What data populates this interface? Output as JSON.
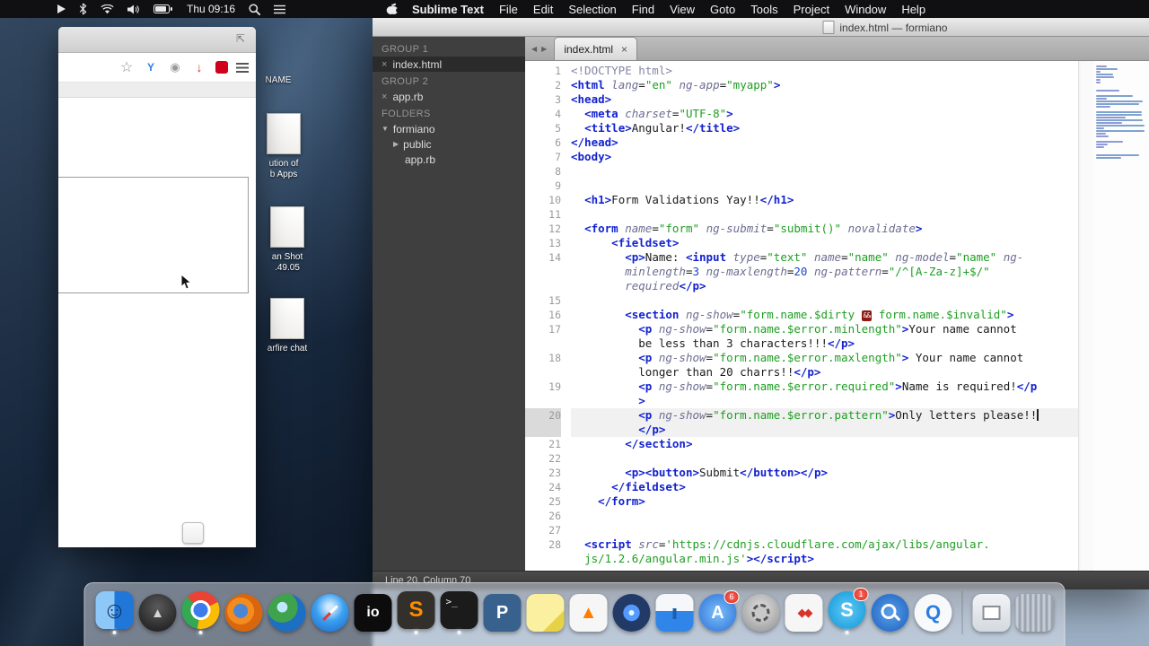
{
  "menubar": {
    "status_icons_pre": [
      "play",
      "bluetooth",
      "wifi",
      "volume",
      "battery"
    ],
    "status_icons_post": [
      "spotlight",
      "list"
    ],
    "clock": "Thu 09:16",
    "app_name": "Sublime Text",
    "menus": [
      "File",
      "Edit",
      "Selection",
      "Find",
      "View",
      "Goto",
      "Tools",
      "Project",
      "Window",
      "Help"
    ]
  },
  "browser": {
    "toolbar_icons": [
      "star",
      "share",
      "shield",
      "download",
      "adblock",
      "menu"
    ]
  },
  "desktop": {
    "icons": [
      {
        "label_lines": [
          "NAME"
        ],
        "thumb": false
      },
      {
        "label_lines": [
          "ution of",
          "b Apps"
        ],
        "thumb": true
      },
      {
        "label_lines": [
          "an Shot",
          ".49.05"
        ],
        "thumb": true
      },
      {
        "label_lines": [
          "arfire chat"
        ],
        "thumb": true
      }
    ]
  },
  "sublime": {
    "title": "index.html — formiano",
    "tab": {
      "label": "index.html"
    },
    "status": "Line 20, Column 70",
    "sidebar": {
      "sections": [
        {
          "header": "GROUP 1",
          "rows": [
            {
              "t": "file",
              "label": "index.html",
              "close": true,
              "selected": true,
              "indent": 0
            }
          ]
        },
        {
          "header": "GROUP 2",
          "rows": [
            {
              "t": "file",
              "label": "app.rb",
              "close": true,
              "indent": 0
            }
          ]
        },
        {
          "header": "FOLDERS",
          "rows": [
            {
              "t": "folder-open",
              "label": "formiano",
              "indent": 0
            },
            {
              "t": "folder",
              "label": "public",
              "indent": 1
            },
            {
              "t": "plain",
              "label": "app.rb",
              "indent": 2
            }
          ]
        }
      ]
    },
    "editor": {
      "rows": [
        {
          "n": "1",
          "seg": [
            [
              "doc",
              "<!DOCTYPE html>"
            ]
          ]
        },
        {
          "n": "2",
          "seg": [
            [
              "tag",
              "<html"
            ],
            [
              "pln",
              " "
            ],
            [
              "att",
              "lang"
            ],
            [
              "pun",
              "="
            ],
            [
              "str",
              "\"en\""
            ],
            [
              "pln",
              " "
            ],
            [
              "att",
              "ng-app"
            ],
            [
              "pun",
              "="
            ],
            [
              "str",
              "\"myapp\""
            ],
            [
              "tag",
              ">"
            ]
          ]
        },
        {
          "n": "3",
          "seg": [
            [
              "tag",
              "<head>"
            ]
          ]
        },
        {
          "n": "4",
          "seg": [
            [
              "pln",
              "  "
            ],
            [
              "tag",
              "<meta"
            ],
            [
              "pln",
              " "
            ],
            [
              "att",
              "charset"
            ],
            [
              "pun",
              "="
            ],
            [
              "str",
              "\"UTF-8\""
            ],
            [
              "tag",
              ">"
            ]
          ]
        },
        {
          "n": "5",
          "seg": [
            [
              "pln",
              "  "
            ],
            [
              "tag",
              "<title>"
            ],
            [
              "pln",
              "Angular!"
            ],
            [
              "tag",
              "</title>"
            ]
          ]
        },
        {
          "n": "6",
          "seg": [
            [
              "tag",
              "</head>"
            ]
          ]
        },
        {
          "n": "7",
          "seg": [
            [
              "tag",
              "<body>"
            ]
          ]
        },
        {
          "n": "8",
          "seg": []
        },
        {
          "n": "9",
          "seg": []
        },
        {
          "n": "10",
          "seg": [
            [
              "pln",
              "  "
            ],
            [
              "tag",
              "<h1>"
            ],
            [
              "pln",
              "Form Validations Yay!!"
            ],
            [
              "tag",
              "</h1>"
            ]
          ]
        },
        {
          "n": "11",
          "seg": []
        },
        {
          "n": "12",
          "seg": [
            [
              "pln",
              "  "
            ],
            [
              "tag",
              "<form"
            ],
            [
              "pln",
              " "
            ],
            [
              "att",
              "name"
            ],
            [
              "pun",
              "="
            ],
            [
              "str",
              "\"form\""
            ],
            [
              "pln",
              " "
            ],
            [
              "att",
              "ng-submit"
            ],
            [
              "pun",
              "="
            ],
            [
              "str",
              "\"submit()\""
            ],
            [
              "pln",
              " "
            ],
            [
              "att",
              "novalidate"
            ],
            [
              "tag",
              ">"
            ]
          ]
        },
        {
          "n": "13",
          "seg": [
            [
              "pln",
              "      "
            ],
            [
              "tag",
              "<fieldset>"
            ]
          ]
        },
        {
          "n": "14",
          "seg": [
            [
              "pln",
              "        "
            ],
            [
              "tag",
              "<p>"
            ],
            [
              "pln",
              "Name: "
            ],
            [
              "tag",
              "<input"
            ],
            [
              "pln",
              " "
            ],
            [
              "att",
              "type"
            ],
            [
              "pun",
              "="
            ],
            [
              "str",
              "\"text\""
            ],
            [
              "pln",
              " "
            ],
            [
              "att",
              "name"
            ],
            [
              "pun",
              "="
            ],
            [
              "str",
              "\"name\""
            ],
            [
              "pln",
              " "
            ],
            [
              "att",
              "ng-model"
            ],
            [
              "pun",
              "="
            ],
            [
              "str",
              "\"name\""
            ],
            [
              "pln",
              " "
            ],
            [
              "att",
              "ng-"
            ]
          ]
        },
        {
          "seg": [
            [
              "pln",
              "        "
            ],
            [
              "att",
              "minlength"
            ],
            [
              "pun",
              "="
            ],
            [
              "num",
              "3"
            ],
            [
              "pln",
              " "
            ],
            [
              "att",
              "ng-maxlength"
            ],
            [
              "pun",
              "="
            ],
            [
              "num",
              "20"
            ],
            [
              "pln",
              " "
            ],
            [
              "att",
              "ng-pattern"
            ],
            [
              "pun",
              "="
            ],
            [
              "str",
              "\"/^[A-Za-z]+$/\""
            ]
          ]
        },
        {
          "seg": [
            [
              "pln",
              "        "
            ],
            [
              "att",
              "required"
            ],
            [
              "tag",
              "</p>"
            ]
          ]
        },
        {
          "n": "15",
          "seg": []
        },
        {
          "n": "16",
          "seg": [
            [
              "pln",
              "        "
            ],
            [
              "tag",
              "<section"
            ],
            [
              "pln",
              " "
            ],
            [
              "att",
              "ng-show"
            ],
            [
              "pun",
              "="
            ],
            [
              "str",
              "\"form.name.$dirty "
            ],
            [
              "box",
              "&&"
            ],
            [
              "str",
              " form.name.$invalid\""
            ],
            [
              "tag",
              ">"
            ]
          ]
        },
        {
          "n": "17",
          "seg": [
            [
              "pln",
              "          "
            ],
            [
              "tag",
              "<p"
            ],
            [
              "pln",
              " "
            ],
            [
              "att",
              "ng-show"
            ],
            [
              "pun",
              "="
            ],
            [
              "str",
              "\"form.name.$error.minlength\""
            ],
            [
              "tag",
              ">"
            ],
            [
              "pln",
              "Your name cannot"
            ]
          ]
        },
        {
          "seg": [
            [
              "pln",
              "          "
            ],
            [
              "pln",
              "be less than 3 characters!!!"
            ],
            [
              "tag",
              "</p>"
            ]
          ]
        },
        {
          "n": "18",
          "seg": [
            [
              "pln",
              "          "
            ],
            [
              "tag",
              "<p"
            ],
            [
              "pln",
              " "
            ],
            [
              "att",
              "ng-show"
            ],
            [
              "pun",
              "="
            ],
            [
              "str",
              "\"form.name.$error.maxlength\""
            ],
            [
              "tag",
              ">"
            ],
            [
              "pln",
              " Your name cannot"
            ]
          ]
        },
        {
          "seg": [
            [
              "pln",
              "          "
            ],
            [
              "pln",
              "longer than 20 charrs!!"
            ],
            [
              "tag",
              "</p>"
            ]
          ]
        },
        {
          "n": "19",
          "seg": [
            [
              "pln",
              "          "
            ],
            [
              "tag",
              "<p"
            ],
            [
              "pln",
              " "
            ],
            [
              "att",
              "ng-show"
            ],
            [
              "pun",
              "="
            ],
            [
              "str",
              "\"form.name.$error.required\""
            ],
            [
              "tag",
              ">"
            ],
            [
              "pln",
              "Name is required!"
            ],
            [
              "tag",
              "</p"
            ]
          ]
        },
        {
          "seg": [
            [
              "pln",
              "          "
            ],
            [
              "tag",
              ">"
            ]
          ]
        },
        {
          "n": "20",
          "hl": true,
          "caret": true,
          "seg": [
            [
              "pln",
              "          "
            ],
            [
              "tag",
              "<p"
            ],
            [
              "pln",
              " "
            ],
            [
              "att",
              "ng-show"
            ],
            [
              "pun",
              "="
            ],
            [
              "str",
              "\"form.name.$error.pattern\""
            ],
            [
              "tag",
              ">"
            ],
            [
              "pln",
              "Only letters please!!"
            ]
          ]
        },
        {
          "hl": true,
          "seg": [
            [
              "pln",
              "          "
            ],
            [
              "tag",
              "</p>"
            ]
          ]
        },
        {
          "n": "21",
          "seg": [
            [
              "pln",
              "        "
            ],
            [
              "tag",
              "</section>"
            ]
          ]
        },
        {
          "n": "22",
          "seg": []
        },
        {
          "n": "23",
          "seg": [
            [
              "pln",
              "        "
            ],
            [
              "tag",
              "<p>"
            ],
            [
              "tag",
              "<button>"
            ],
            [
              "pln",
              "Submit"
            ],
            [
              "tag",
              "</button>"
            ],
            [
              "tag",
              "</p>"
            ]
          ]
        },
        {
          "n": "24",
          "seg": [
            [
              "pln",
              "      "
            ],
            [
              "tag",
              "</fieldset>"
            ]
          ]
        },
        {
          "n": "25",
          "seg": [
            [
              "pln",
              "    "
            ],
            [
              "tag",
              "</form>"
            ]
          ]
        },
        {
          "n": "26",
          "seg": []
        },
        {
          "n": "27",
          "seg": []
        },
        {
          "n": "28",
          "seg": [
            [
              "pln",
              "  "
            ],
            [
              "tag",
              "<script"
            ],
            [
              "pln",
              " "
            ],
            [
              "att",
              "src"
            ],
            [
              "pun",
              "="
            ],
            [
              "str",
              "'https://cdnjs.cloudflare.com/ajax/libs/angular."
            ]
          ]
        },
        {
          "seg": [
            [
              "pln",
              "  "
            ],
            [
              "str",
              "js/1.2.6/angular.min.js'"
            ],
            [
              "tag",
              "></script>"
            ]
          ]
        }
      ]
    }
  },
  "dock": {
    "items": [
      {
        "name": "finder",
        "running": true
      },
      {
        "name": "launchpad"
      },
      {
        "name": "chrome",
        "running": true
      },
      {
        "name": "firefox"
      },
      {
        "name": "earth-browser"
      },
      {
        "name": "safari"
      },
      {
        "name": "io-app"
      },
      {
        "name": "sublime-text",
        "running": true
      },
      {
        "name": "terminal",
        "running": true
      },
      {
        "name": "postgres"
      },
      {
        "name": "stickies"
      },
      {
        "name": "vlc"
      },
      {
        "name": "photo-booth"
      },
      {
        "name": "keynote"
      },
      {
        "name": "app-store",
        "badge": "6"
      },
      {
        "name": "system-preferences"
      },
      {
        "name": "red-diamond-app"
      },
      {
        "name": "skype",
        "badge": "1",
        "running": true
      },
      {
        "name": "search-app"
      },
      {
        "name": "quicktime"
      },
      {
        "name": "separator"
      },
      {
        "name": "archive-utility"
      },
      {
        "name": "trash"
      }
    ]
  }
}
